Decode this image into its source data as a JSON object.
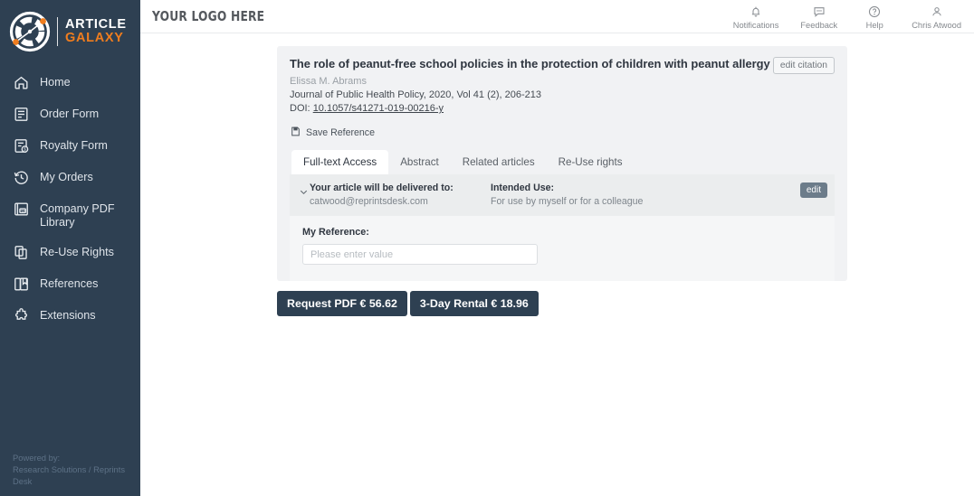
{
  "sidebar": {
    "brand": {
      "line1": "ARTICLE",
      "line2": "GALAXY",
      "logo_icon": "article-galaxy-logo-icon"
    },
    "items": [
      {
        "label": "Home",
        "icon": "home-icon"
      },
      {
        "label": "Order Form",
        "icon": "order-form-icon"
      },
      {
        "label": "Royalty Form",
        "icon": "royalty-form-icon"
      },
      {
        "label": "My Orders",
        "icon": "history-clock-icon"
      },
      {
        "label": "Company PDF Library",
        "icon": "pdf-library-icon"
      },
      {
        "label": "Re-Use Rights",
        "icon": "copy-documents-icon"
      },
      {
        "label": "References",
        "icon": "book-references-icon"
      },
      {
        "label": "Extensions",
        "icon": "puzzle-extensions-icon"
      }
    ],
    "powered_by_label": "Powered by:",
    "powered_by_value": "Research Solutions / Reprints Desk"
  },
  "topbar": {
    "logo_text": "YOUR LOGO HERE",
    "actions": [
      {
        "label": "Notifications",
        "icon": "bell-icon"
      },
      {
        "label": "Feedback",
        "icon": "feedback-comment-icon"
      },
      {
        "label": "Help",
        "icon": "question-circle-icon"
      },
      {
        "label": "Chris Atwood",
        "icon": "user-account-icon"
      }
    ]
  },
  "citation": {
    "title": "The role of peanut-free school policies in the protection of children with peanut allergy",
    "authors": "Elissa M. Abrams",
    "journal": "Journal of Public Health Policy, 2020, Vol 41 (2), 206-213",
    "doi_label": "DOI:",
    "doi_value": "10.1057/s41271-019-00216-y",
    "edit_citation_label": "edit citation",
    "save_reference_label": "Save Reference",
    "save_reference_icon": "save-bookmark-icon"
  },
  "tabs": [
    {
      "label": "Full-text Access",
      "active": true
    },
    {
      "label": "Abstract",
      "active": false
    },
    {
      "label": "Related articles",
      "active": false
    },
    {
      "label": "Re-Use rights",
      "active": false
    }
  ],
  "delivery": {
    "chevron_icon": "chevron-down-icon",
    "delivered_to_label": "Your article will be delivered to:",
    "delivered_to_value": "catwood@reprintsdesk.com",
    "intended_use_label": "Intended Use:",
    "intended_use_value": "For use by myself or for a colleague",
    "edit_label": "edit"
  },
  "my_reference": {
    "label": "My Reference:",
    "value": "",
    "placeholder": "Please enter value"
  },
  "actions": {
    "request_pdf_label": "Request PDF € 56.62",
    "rental_label": "3-Day Rental € 18.96"
  },
  "colors": {
    "sidebar_bg": "#2e4052",
    "brand_orange": "#f07d1e",
    "primary_button": "#2e4052",
    "card_bg": "#f1f2f4",
    "edit_button": "#6c7c8a"
  }
}
